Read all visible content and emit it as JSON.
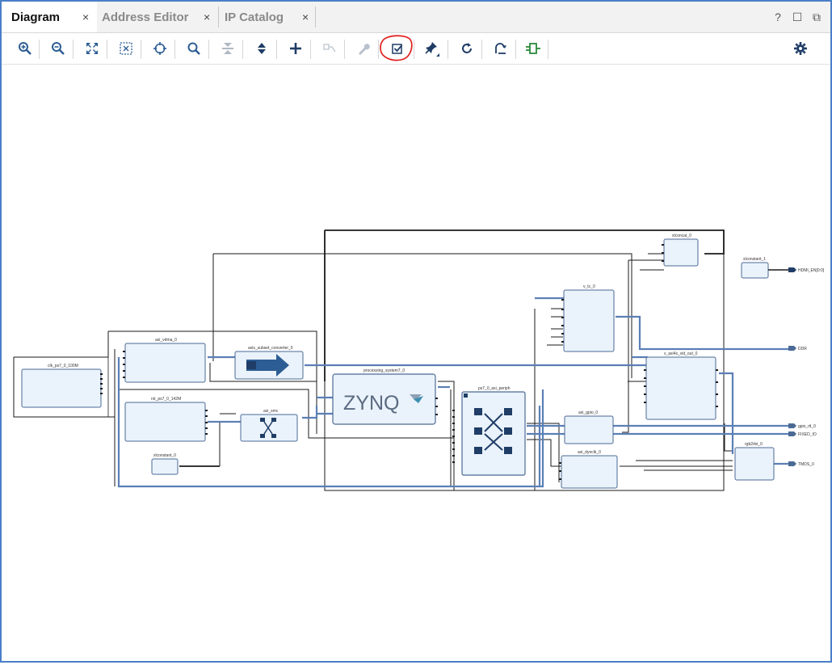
{
  "tabs": [
    {
      "label": "Diagram",
      "active": true
    },
    {
      "label": "Address Editor",
      "active": false
    },
    {
      "label": "IP Catalog",
      "active": false
    }
  ],
  "close_glyph": "×",
  "window_controls": {
    "help": "?",
    "restore": "☐",
    "float": "⧉"
  },
  "toolbar": [
    {
      "name": "zoom-in-icon"
    },
    {
      "name": "zoom-out-icon"
    },
    {
      "name": "zoom-fit-icon"
    },
    {
      "name": "zoom-area-icon"
    },
    {
      "name": "center-icon"
    },
    {
      "name": "search-icon"
    },
    {
      "name": "collapse-all-icon"
    },
    {
      "name": "expand-all-icon"
    },
    {
      "name": "add-ip-icon"
    },
    {
      "name": "make-connection-icon"
    },
    {
      "name": "customize-block-icon"
    },
    {
      "name": "validate-design-icon"
    },
    {
      "name": "pin-icon"
    },
    {
      "name": "regenerate-layout-icon"
    },
    {
      "name": "optimize-routing-icon"
    },
    {
      "name": "add-module-icon"
    },
    {
      "name": "settings-icon"
    }
  ],
  "colors": {
    "accent": "#4a7ec8",
    "block_fill": "#eaf2fb",
    "block_border": "#4b6a95",
    "bus": "#5b7fb6",
    "wire": "#1a1a1a",
    "highlight": "#e02020"
  },
  "blocks": {
    "clk_100": "clk_ps7_0_100M",
    "vdma": "axi_vdma_0",
    "axis_conv": "axis_subset_converter_0",
    "rst_142": "rst_ps7_0_142M",
    "smc": "axi_smc",
    "const0": "xlconstant_0",
    "ps7": "processing_system7_0",
    "zynq_logo": "ZYNQ",
    "periph": "ps7_0_axi_periph",
    "concat": "xlconcat_0",
    "const1": "xlconstant_1",
    "vtc": "v_tc_0",
    "vid_out": "v_axi4s_vid_out_0",
    "gpio": "axi_gpio_0",
    "dynclk": "axi_dynclk_0",
    "rgb2dvi": "rgb2dvi_0"
  },
  "ports": {
    "hdmi": "HDMI_EN[0:0]",
    "ddr": "DDR",
    "gpio": "gpio_rtl_0",
    "fixed_io": "FIXED_IO",
    "tmds": "TMDS_0"
  }
}
